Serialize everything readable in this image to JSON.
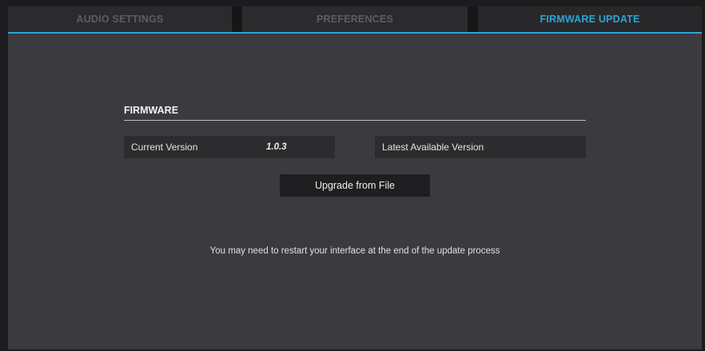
{
  "tabs": [
    {
      "label": "AUDIO SETTINGS",
      "active": false
    },
    {
      "label": "PREFERENCES",
      "active": false
    },
    {
      "label": "FIRMWARE UPDATE",
      "active": true
    }
  ],
  "firmware": {
    "section_title": "FIRMWARE",
    "current_version_label": "Current Version",
    "current_version_value": "1.0.3",
    "latest_version_label": "Latest Available Version",
    "upgrade_button_label": "Upgrade from File",
    "notice": "You may need to restart your interface at the end of the update process"
  },
  "colors": {
    "accent": "#2fa3d6",
    "panel_background": "#3b3b3f",
    "window_background": "#1c1c1e"
  }
}
